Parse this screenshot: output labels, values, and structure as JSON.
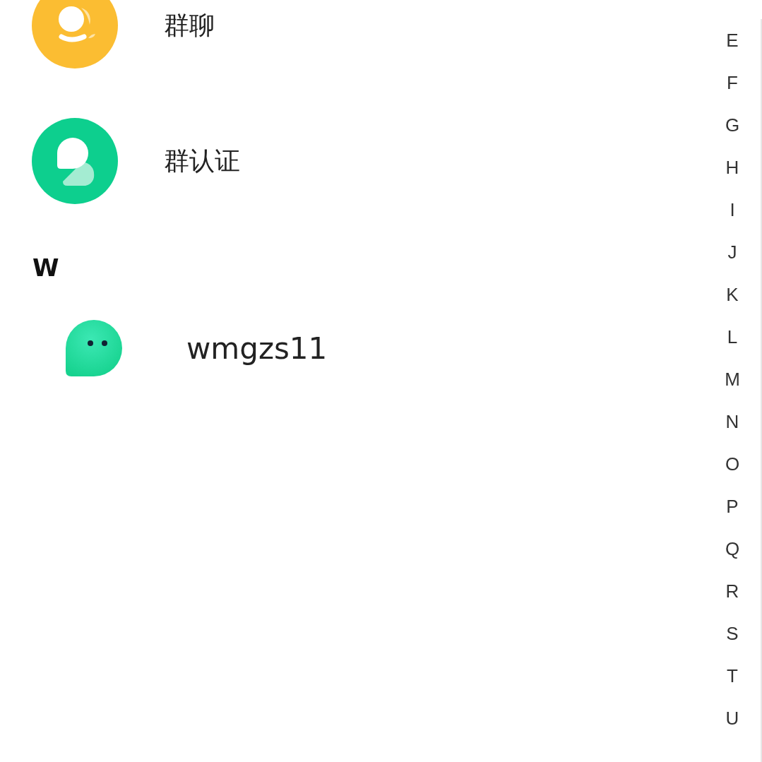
{
  "entries": [
    {
      "kind": "group-chat",
      "label": "群聊"
    },
    {
      "kind": "group-verify",
      "label": "群认证"
    }
  ],
  "sections": [
    {
      "letter": "W",
      "contacts": [
        {
          "name": "wmgzs11"
        }
      ]
    }
  ],
  "index": [
    "E",
    "F",
    "G",
    "H",
    "I",
    "J",
    "K",
    "L",
    "M",
    "N",
    "O",
    "P",
    "Q",
    "R",
    "S",
    "T",
    "U"
  ]
}
